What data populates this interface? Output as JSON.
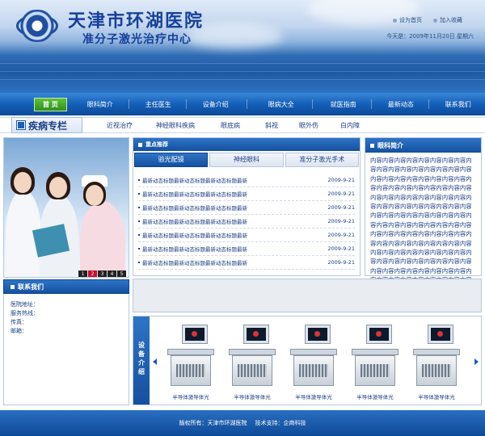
{
  "header": {
    "title": "天津市环湖医院",
    "subtitle": "准分子激光治疗中心",
    "links": [
      "设为首页",
      "加入收藏"
    ],
    "date": "今天是：2009年11月20日 星期六"
  },
  "nav": {
    "items": [
      "首 页",
      "眼科简介",
      "主任医生",
      "设备介绍",
      "眼病大全",
      "就医指南",
      "最新动态",
      "联系我们"
    ]
  },
  "subnav": {
    "special": "疾病专栏",
    "items": [
      "近视治疗",
      "神经眼科疾病",
      "眼底病",
      "斜视",
      "眼外伤",
      "白内障"
    ]
  },
  "slideshow": {
    "pages": [
      "1",
      "2",
      "3",
      "4",
      "5"
    ],
    "active": 1
  },
  "contact": {
    "title": "联系我们",
    "lines": [
      "医院地址：",
      "服务热线：",
      "传真：",
      "邮箱："
    ]
  },
  "news": {
    "head": "重点推荐",
    "tabs": [
      "验光配镜",
      "神经眼科",
      "准分子激光手术"
    ],
    "rows": [
      {
        "title": "最新动态标题最新动态标题最新动态标题最新",
        "date": "2009-9-21"
      },
      {
        "title": "最新动态标题最新动态标题最新动态标题最新",
        "date": "2009-9-21"
      },
      {
        "title": "最新动态标题最新动态标题最新动态标题最新",
        "date": "2009-9-21"
      },
      {
        "title": "最新动态标题最新动态标题最新动态标题最新",
        "date": "2009-9-21"
      },
      {
        "title": "最新动态标题最新动态标题最新动态标题最新",
        "date": "2009-9-21"
      },
      {
        "title": "最新动态标题最新动态标题最新动态标题最新",
        "date": "2009-9-21"
      },
      {
        "title": "最新动态标题最新动态标题最新动态标题最新",
        "date": "2009-9-21"
      }
    ]
  },
  "intro": {
    "title": "眼科简介",
    "text": "内容内容内容内容内容内容内容内容内容内容内容内容内容内容内容内容内容内容内容内容内容内容内容内容内容内容内容内容内容内容内容内容内容内容内容内容内容内容内容内容内容内容内容内容内容内容内容内容内容内容内容内容内容内容内容内容内容内容内容内容内容内容内容内容内容内容内容内容内容内容内容内容内容内容内容内容内容内容内容内容内容内容内容内容内容内容内容内容内容内容内容内容内容内容内容内容内容内容内容内容内容内容内容内容内容内容内容内容内容内容内容内容内容内容内容内容内容内容内容内容内容内容内容内容内容内容内容内容内容内容内容内容内容内容内容内容内容内容"
  },
  "equipment": {
    "label": "设备介绍",
    "items": [
      "半导体激导体光",
      "半导体激导体光",
      "半导体激导体光",
      "半导体激导体光",
      "半导体激导体光"
    ]
  },
  "footer": {
    "copyright": "版权所有：天津市环湖医院",
    "support": "技术支持：企商科技"
  }
}
